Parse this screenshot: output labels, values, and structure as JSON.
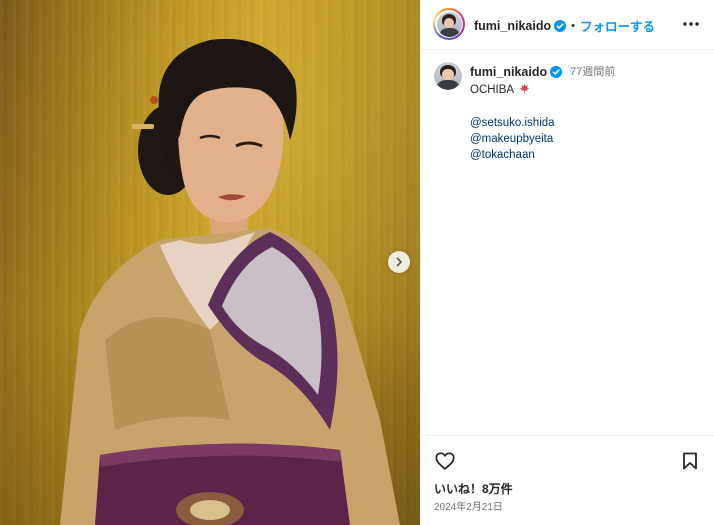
{
  "header": {
    "username": "fumi_nikaido",
    "separator": "•",
    "follow_label": "フォローする"
  },
  "caption": {
    "username": "fumi_nikaido",
    "time": "77週間前",
    "text": "OCHIBA",
    "emoji_icon": "maple-leaf-icon",
    "mentions": [
      "@setsuko.ishida",
      "@makeupbyeita",
      "@tokachaan"
    ]
  },
  "footer": {
    "likes": "いいね！8万件",
    "date": "2024年2月21日"
  },
  "colors": {
    "accent": "#0095f6",
    "mention": "#00376b",
    "verified": "#0095f6",
    "muted": "#737373"
  }
}
